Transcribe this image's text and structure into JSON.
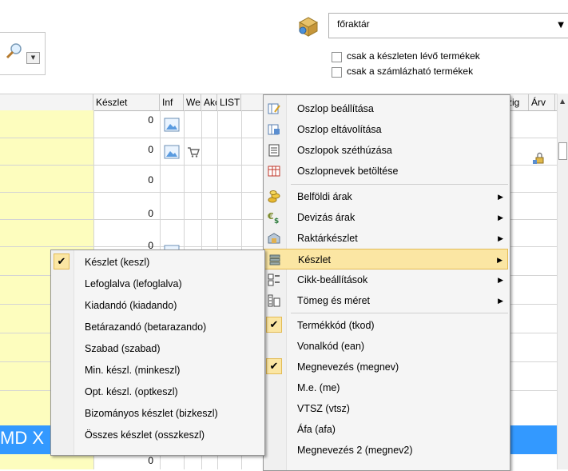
{
  "toolbar": {
    "warehouse_select": "főraktár",
    "filter_in_stock": "csak a készleten lévő termékek",
    "filter_billable": "csak a számlázható termékek"
  },
  "grid": {
    "headers": [
      "Készlet",
      "Inf",
      "Web",
      "Akc",
      "LIST",
      "zig",
      "Árv"
    ],
    "stock_values": [
      "0",
      "0",
      "0",
      "0",
      "0",
      "0"
    ],
    "selected_row_text": "MD X"
  },
  "context_menu": {
    "items": [
      {
        "label": "Oszlop beállítása",
        "icon": "column-settings-icon"
      },
      {
        "label": "Oszlop eltávolítása",
        "icon": "column-remove-icon"
      },
      {
        "label": "Oszlopok széthúzása",
        "icon": "columns-stretch-icon"
      },
      {
        "label": "Oszlopnevek betöltése",
        "icon": "column-names-load-icon"
      },
      {
        "label": "Belföldi árak",
        "icon": "coins-icon"
      },
      {
        "label": "Devizás árak",
        "icon": "currency-icon"
      },
      {
        "label": "Raktárkészlet",
        "icon": "warehouse-icon"
      },
      {
        "label": "Készlet",
        "icon": "stock-icon"
      },
      {
        "label": "Cikk-beállítások",
        "icon": "item-settings-icon"
      },
      {
        "label": "Tömeg és méret",
        "icon": "weight-size-icon"
      },
      {
        "label": "Termékkód (tkod)",
        "checked": true
      },
      {
        "label": "Vonalkód (ean)",
        "checked": false
      },
      {
        "label": "Megnevezés (megnev)",
        "checked": true
      },
      {
        "label": "M.e. (me)",
        "checked": false
      },
      {
        "label": "VTSZ (vtsz)",
        "checked": false
      },
      {
        "label": "Áfa (afa)",
        "checked": false
      },
      {
        "label": "Megnevezés 2 (megnev2)",
        "checked": false
      }
    ]
  },
  "stock_submenu": {
    "items": [
      {
        "label": "Készlet (keszl)",
        "checked": true
      },
      {
        "label": "Lefoglalva (lefoglalva)",
        "checked": false
      },
      {
        "label": "Kiadandó (kiadando)",
        "checked": false
      },
      {
        "label": "Betárazandó (betarazando)",
        "checked": false
      },
      {
        "label": "Szabad (szabad)",
        "checked": false
      },
      {
        "label": "Min. készl. (minkeszl)",
        "checked": false
      },
      {
        "label": "Opt. készl. (optkeszl)",
        "checked": false
      },
      {
        "label": "Bizományos készlet (bizkeszl)",
        "checked": false
      },
      {
        "label": "Összes készlet (osszkeszl)",
        "checked": false
      }
    ]
  },
  "colors": {
    "menu_highlight": "#fbe6a3",
    "selected_row": "#3399ff",
    "yellow_column": "#fdfdbe"
  }
}
